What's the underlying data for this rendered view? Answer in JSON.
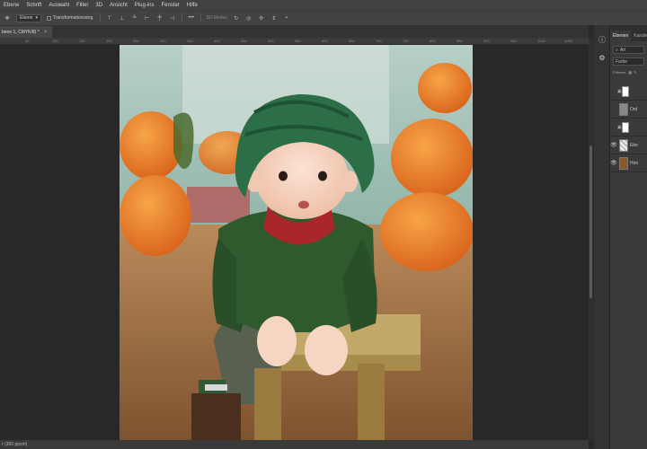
{
  "menu": [
    "Ebene",
    "Schrift",
    "Auswahl",
    "Filter",
    "3D",
    "Ansicht",
    "Plug-ins",
    "Fenster",
    "Hilfe"
  ],
  "options": {
    "layer_select": "Ebene",
    "transform_label": "Transformationsstrg.",
    "mode_label": "3D-Modus"
  },
  "document": {
    "tab_title": "bene 1, CMYK/8) *",
    "close_glyph": "×",
    "status": "r (300 ppcm)"
  },
  "ruler": [
    "50",
    "100",
    "150",
    "200",
    "250",
    "300",
    "350",
    "400",
    "450",
    "500",
    "550",
    "600",
    "650",
    "700",
    "750",
    "800",
    "850",
    "900",
    "950",
    "1000",
    "1050"
  ],
  "panel": {
    "tabs": [
      "Ebenen",
      "Kanäle"
    ],
    "search_placeholder": "Art",
    "blend_mode": "Farbe",
    "lock_label": "Fixieren:",
    "layers": [
      {
        "name": "",
        "visible": false,
        "has_mask": true
      },
      {
        "name": "Ord",
        "visible": false,
        "has_mask": false
      },
      {
        "name": "",
        "visible": false,
        "has_mask": true
      },
      {
        "name": "Ebe",
        "visible": true,
        "has_mask": false
      },
      {
        "name": "Hint",
        "visible": true,
        "has_mask": false
      }
    ]
  },
  "icons": {
    "info": "info-icon",
    "adjust": "adjustment-icon",
    "eye": "eye-icon",
    "search": "search-icon"
  },
  "colors": {
    "app_bg": "#282828",
    "panel_bg": "#3a3a3a",
    "menu_bg": "#424242"
  }
}
